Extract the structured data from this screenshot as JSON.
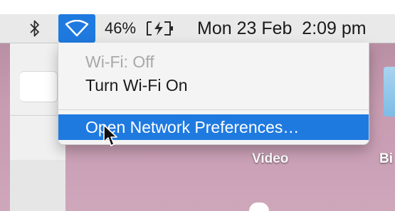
{
  "menubar": {
    "bluetooth_icon": "bluetooth-icon",
    "wifi_icon": "wifi-icon",
    "battery_percent": "46%",
    "battery_icon": "battery-charging-icon",
    "clock": "Mon 23 Feb  2:09 pm",
    "accent_color": "#1f7ae0"
  },
  "wifi_menu": {
    "status_label": "Wi-Fi: Off",
    "turn_on_label": "Turn Wi-Fi On",
    "preferences_label": "Open Network Preferences…"
  },
  "desktop": {
    "icons": [
      {
        "label": "Video"
      },
      {
        "label": "Bi"
      }
    ]
  }
}
